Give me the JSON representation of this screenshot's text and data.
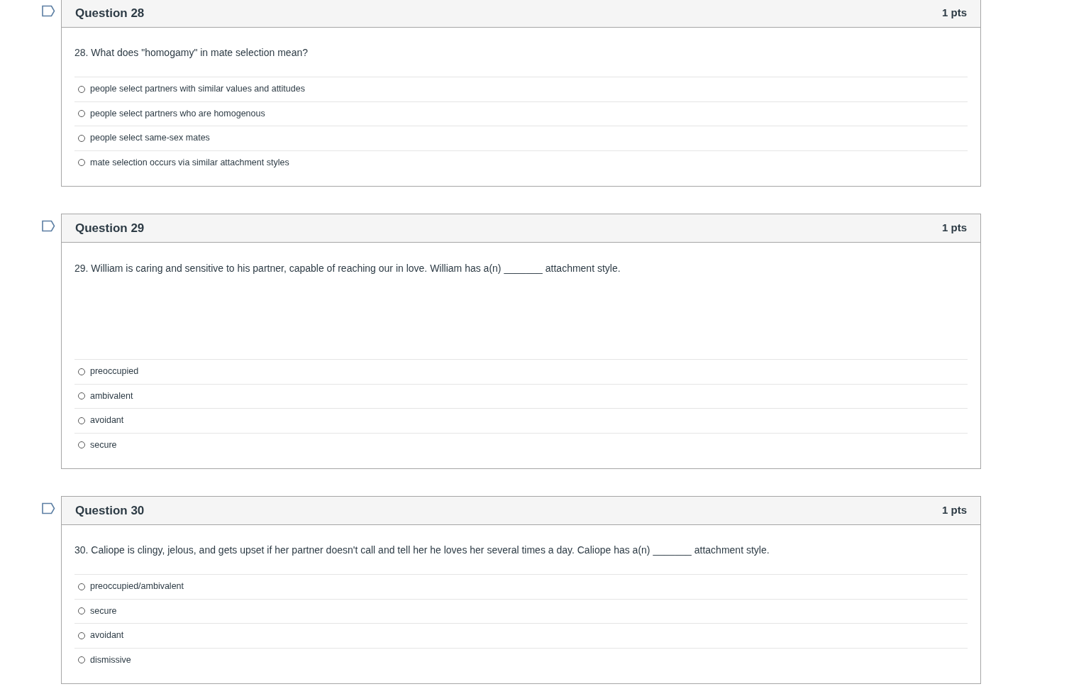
{
  "questions": [
    {
      "title": "Question 28",
      "points": "1 pts",
      "kind": "short",
      "text": "28. What does \"homogamy\" in mate selection mean?",
      "answers": [
        {
          "label": "people select partners with similar values and attitudes",
          "selected": false
        },
        {
          "label": "people select partners who are homogenous",
          "selected": false
        },
        {
          "label": "people select same-sex mates",
          "selected": false
        },
        {
          "label": "mate selection occurs via similar attachment styles",
          "selected": false
        }
      ]
    },
    {
      "title": "Question 29",
      "points": "1 pts",
      "kind": "tall",
      "text": "29. William is caring and sensitive to his partner, capable of reaching our in love. William has a(n) _______ attachment style.",
      "answers": [
        {
          "label": "preoccupied",
          "selected": false
        },
        {
          "label": "ambivalent",
          "selected": false
        },
        {
          "label": "avoidant",
          "selected": false
        },
        {
          "label": "secure",
          "selected": false
        }
      ]
    },
    {
      "title": "Question 30",
      "points": "1 pts",
      "kind": "short",
      "text": "30. Caliope is clingy, jelous, and gets upset if her partner doesn't call and tell her he loves her several times a day. Caliope has a(n) _______ attachment style.",
      "answers": [
        {
          "label": "preoccupied/ambivalent",
          "selected": false
        },
        {
          "label": "secure",
          "selected": false
        },
        {
          "label": "avoidant",
          "selected": false
        },
        {
          "label": "dismissive",
          "selected": false
        }
      ]
    }
  ]
}
